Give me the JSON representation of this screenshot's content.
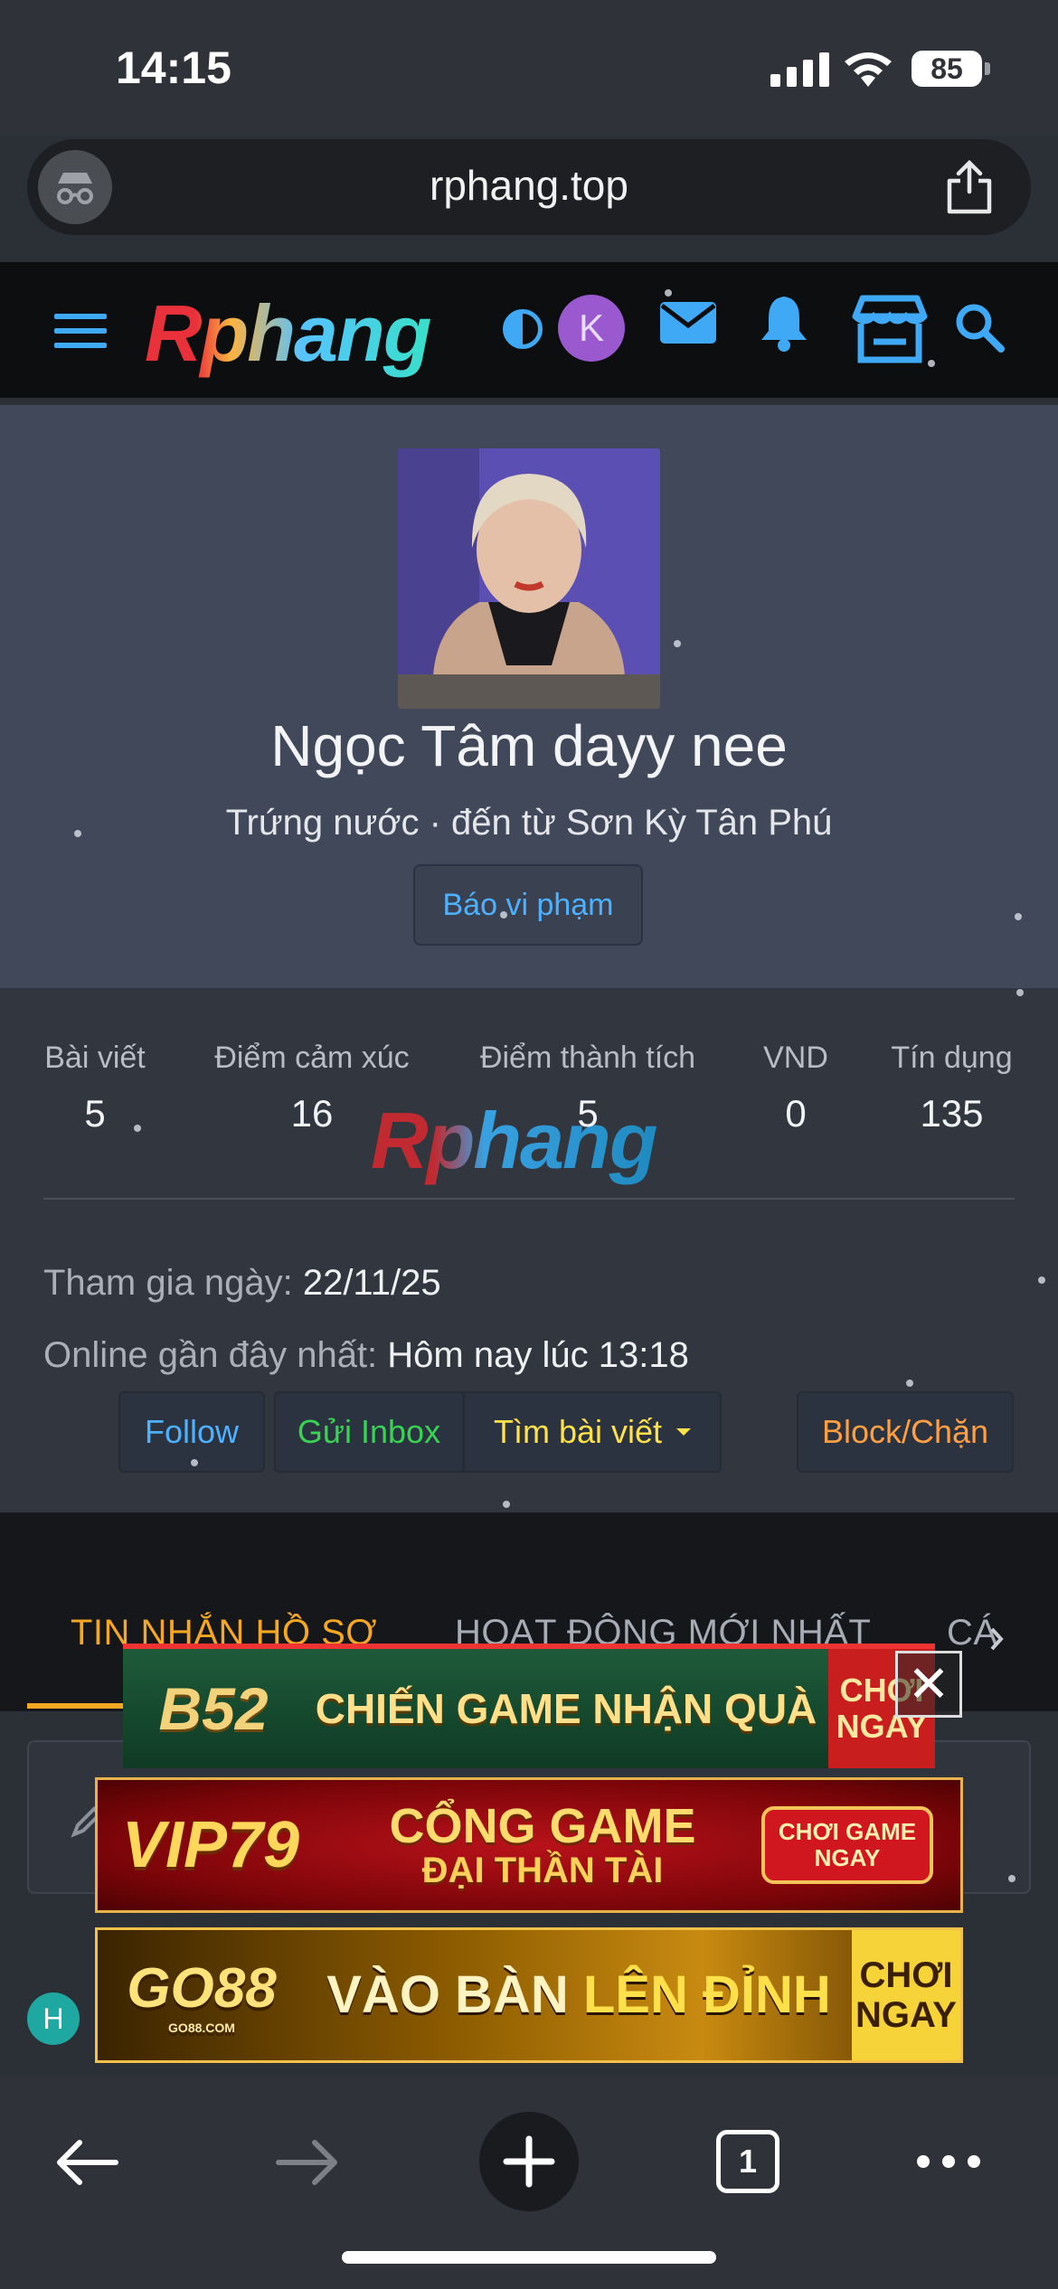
{
  "status_bar": {
    "time": "14:15",
    "battery": "85"
  },
  "browser": {
    "url": "rphang.top"
  },
  "site_header": {
    "logo": "Rphang",
    "avatar_letter": "K"
  },
  "profile": {
    "name": "Ngọc Tâm dayy nee",
    "subtitle": "Trứng nước · đến từ Sơn Kỳ Tân Phú",
    "report_label": "Báo vi phạm"
  },
  "stats": [
    {
      "label": "Bài viết",
      "value": "5"
    },
    {
      "label": "Điểm cảm xúc",
      "value": "16"
    },
    {
      "label": "Điểm thành tích",
      "value": "5"
    },
    {
      "label": "VND",
      "value": "0"
    },
    {
      "label": "Tín dụng",
      "value": "135"
    }
  ],
  "watermark": "Rphang",
  "joined": {
    "label": "Tham gia ngày:",
    "value": "22/11/25"
  },
  "last_online": {
    "label": "Online gần đây nhất:",
    "value": "Hôm nay lúc 13:18"
  },
  "actions": {
    "follow": "Follow",
    "inbox": "Gửi Inbox",
    "find_posts": "Tìm bài viết",
    "block": "Block/Chặn"
  },
  "tabs": [
    "TIN NHẮN HỒ SƠ",
    "HOẠT ĐỘNG MỚI NHẤT",
    "CÁ"
  ],
  "feed": {
    "badge_letter": "H"
  },
  "ads": [
    {
      "brand": "B52",
      "slogan": "CHIẾN GAME NHẬN QUÀ",
      "cta_line1": "CHƠI",
      "cta_line2": "NGAY"
    },
    {
      "brand": "VIP79",
      "slogan_line1": "CỔNG GAME",
      "slogan_line2": "ĐẠI THẦN TÀI",
      "cta_line1": "CHƠI GAME",
      "cta_line2": "NGAY"
    },
    {
      "brand": "GO88",
      "brand_sub": "GO88.COM",
      "slogan_part1": "VÀO BÀN",
      "slogan_part2": "LÊN ĐỈNH",
      "cta_line1": "CHƠI",
      "cta_line2": "NGAY"
    }
  ],
  "toolbar": {
    "tab_count": "1"
  },
  "colors": {
    "accent_blue": "#4db1ff",
    "accent_orange": "#f5a623",
    "green": "#39d353",
    "yellow": "#ffe14a",
    "block_orange": "#ff9f43"
  }
}
